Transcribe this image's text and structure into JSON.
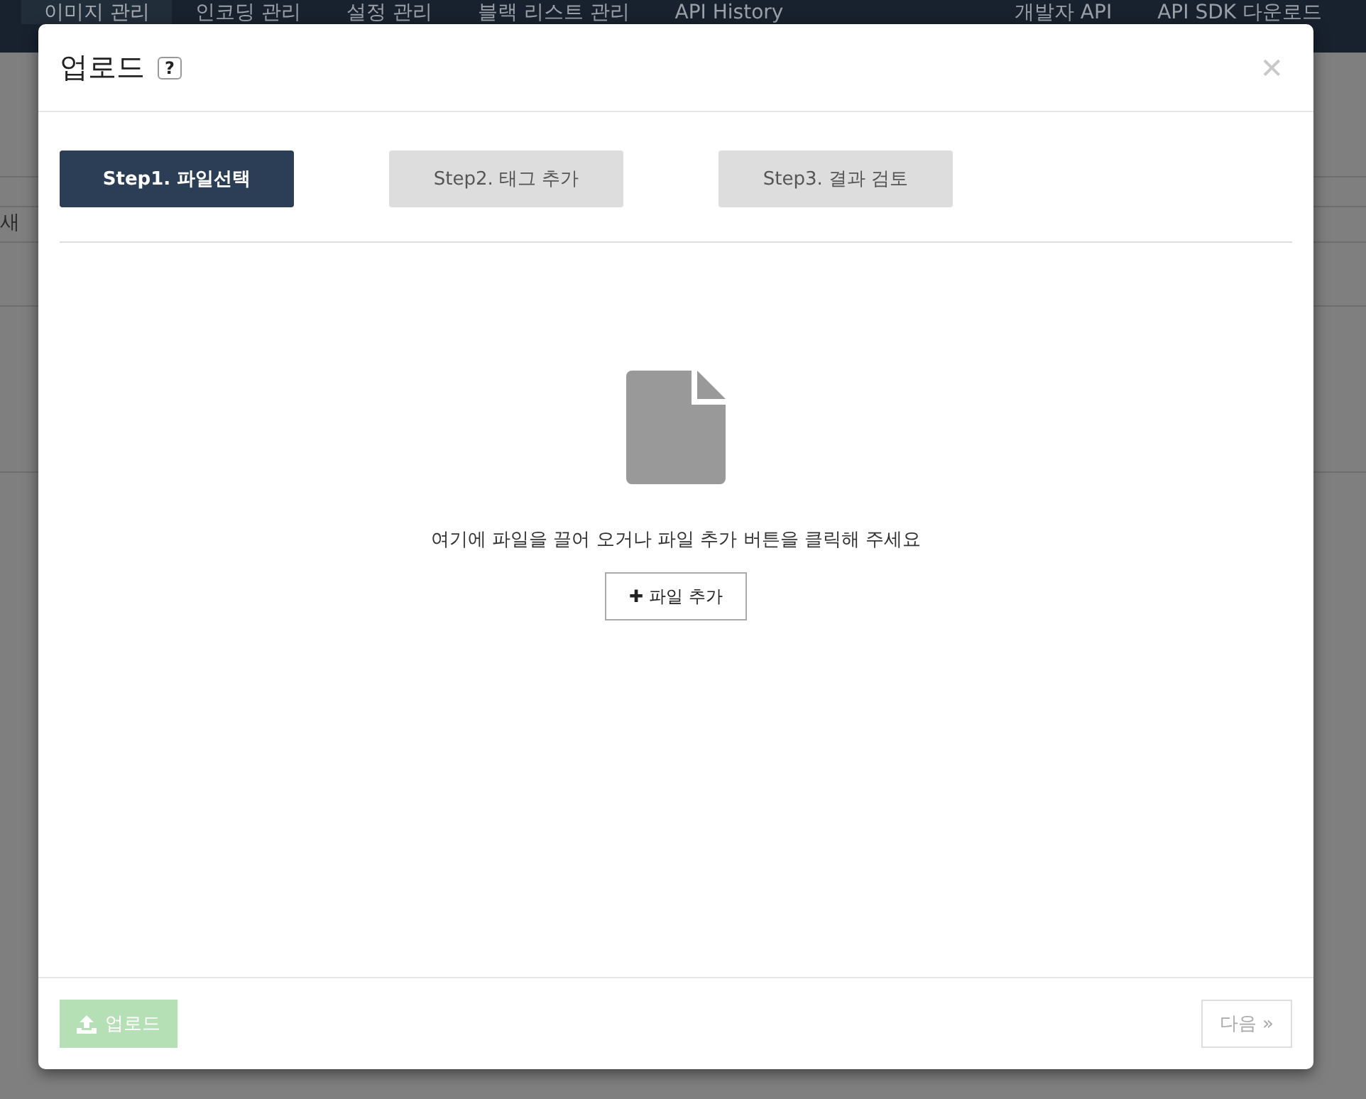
{
  "nav": {
    "items": [
      {
        "label": "이미지 관리",
        "selected": true
      },
      {
        "label": "인코딩 관리",
        "selected": false
      },
      {
        "label": "설정 관리",
        "selected": false
      },
      {
        "label": "블랙 리스트 관리",
        "selected": false
      },
      {
        "label": "API History",
        "selected": false
      }
    ],
    "right_items": [
      {
        "label": "개발자 API"
      },
      {
        "label": "API SDK 다운로드"
      }
    ]
  },
  "page": {
    "button_label": "새"
  },
  "modal": {
    "title": "업로드",
    "help_label": "?",
    "close_label": "✕",
    "steps": [
      {
        "label": "Step1. 파일선택",
        "selected": true
      },
      {
        "label": "Step2. 태그 추가",
        "selected": false
      },
      {
        "label": "Step3. 결과 검토",
        "selected": false
      }
    ],
    "drop_text": "여기에 파일을 끌어 오거나 파일 추가 버튼을 클릭해 주세요",
    "add_button": {
      "label": "파일 추가",
      "icon_label": "✚"
    },
    "upload_button": {
      "label": "업로드",
      "disabled": true
    },
    "next_button": {
      "label": "다음 »",
      "disabled": true
    }
  }
}
